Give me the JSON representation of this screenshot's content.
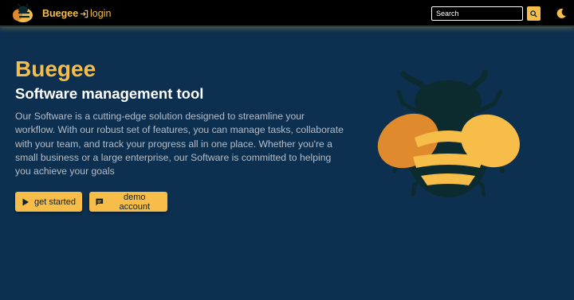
{
  "navbar": {
    "brand_name": "Buegee",
    "login_label": "login",
    "search": {
      "placeholder": "Search",
      "value": ""
    }
  },
  "hero": {
    "title": "Buegee",
    "subtitle": "Software management tool",
    "description": "Our Software is a cutting-edge solution designed to streamline your workflow. With our robust set of features, you can manage tasks, collaborate with your team, and track your progress all in one place. Whether you're a small business or a large enterprise, our Software is committed to helping you achieve your goals",
    "buttons": {
      "get_started": "get started",
      "demo_account": "demo account"
    }
  },
  "icons": {
    "logo": "bee-logo-icon",
    "login": "login-icon",
    "search": "search-icon",
    "theme": "moon-icon",
    "play": "play-icon",
    "demo": "chat-icon",
    "illustration": "bee-illustration"
  },
  "colors": {
    "background": "#0d3050",
    "navbar": "#000000",
    "accent": "#f6be49",
    "accent_dark": "#e08a2e",
    "bee_body": "#0b2b2f",
    "text_light": "#b5bec7"
  }
}
